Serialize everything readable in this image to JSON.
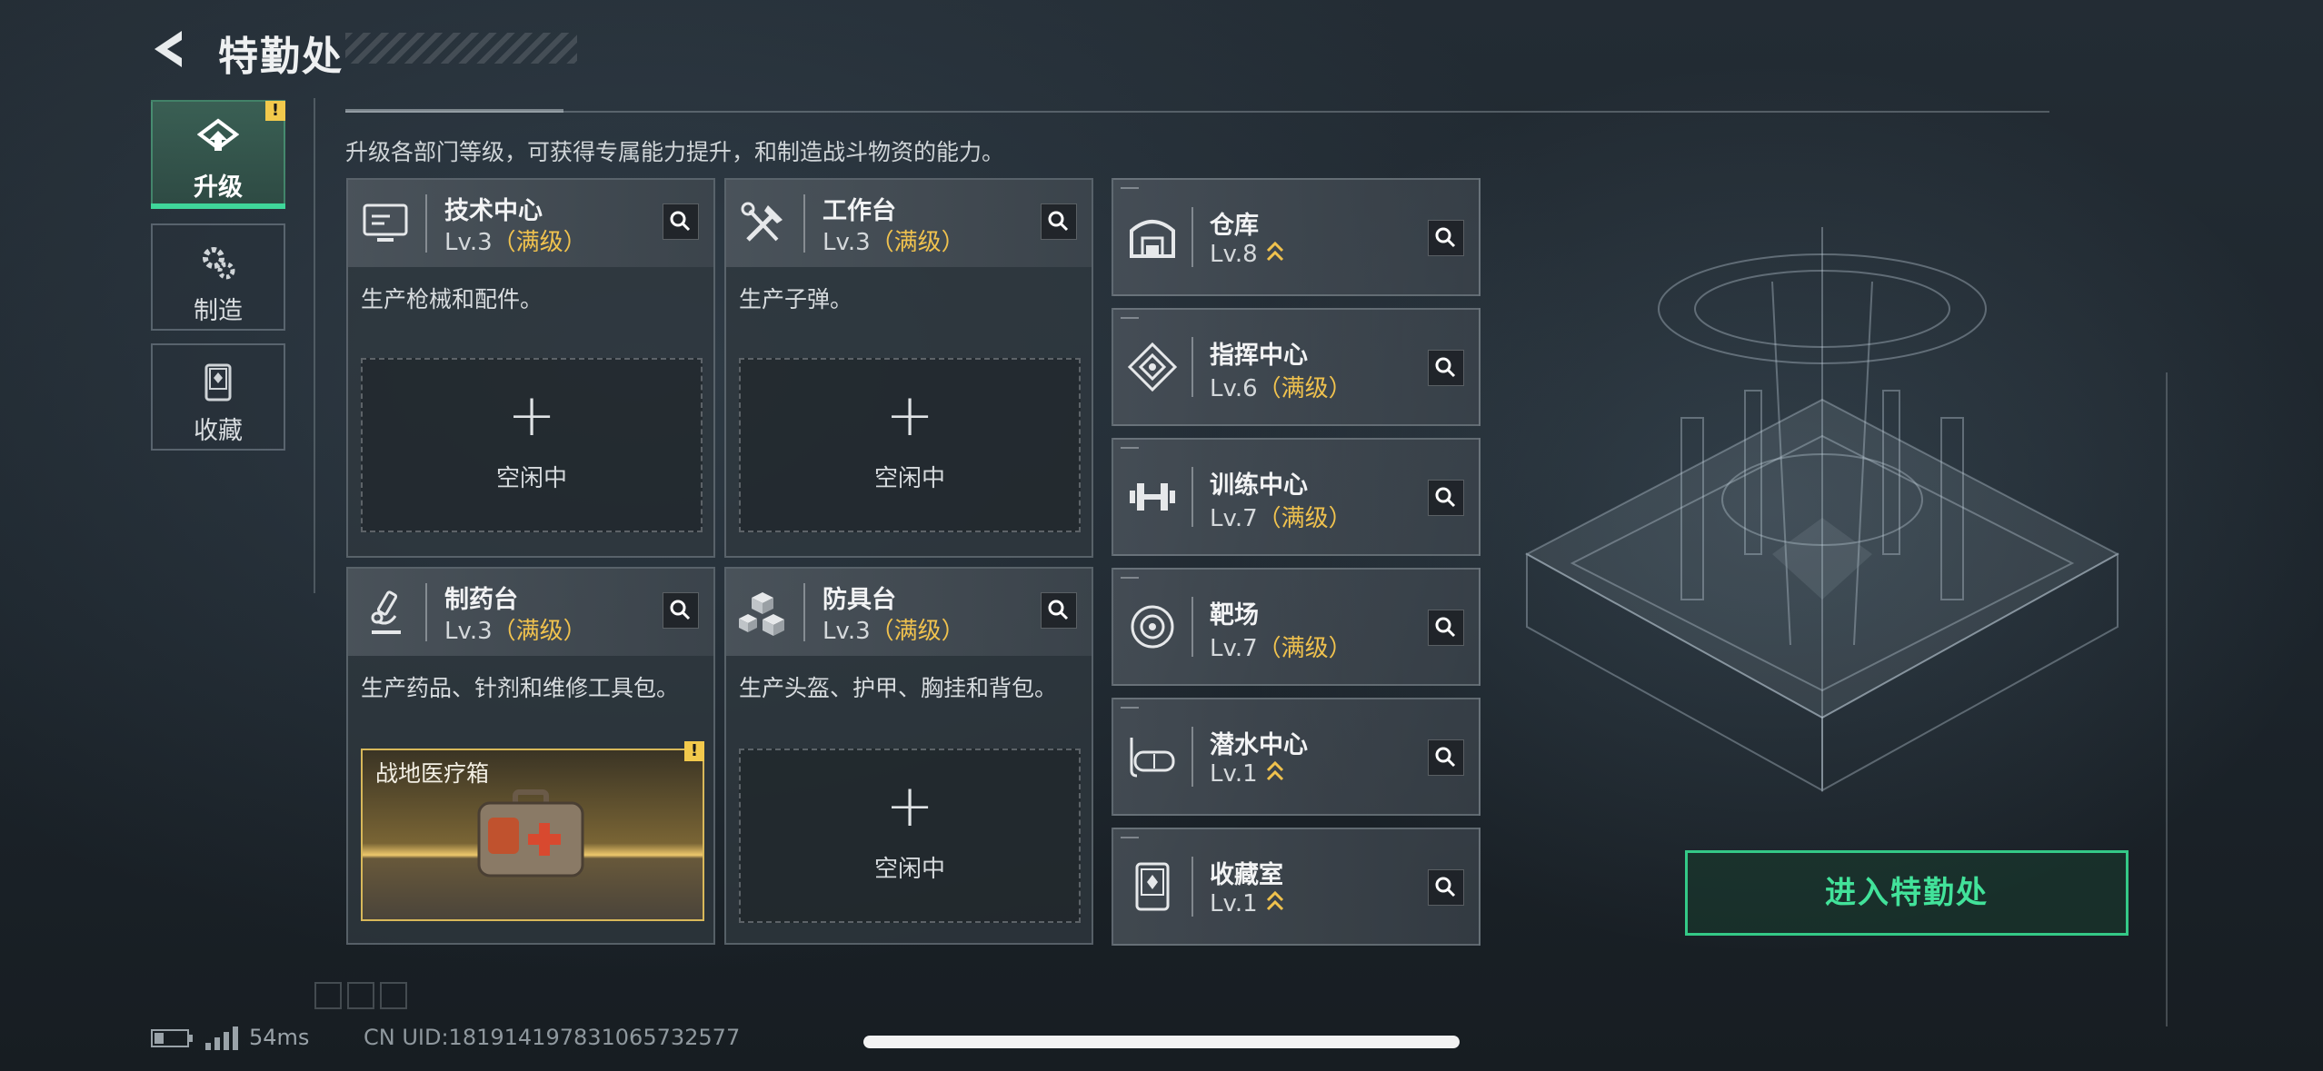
{
  "header": {
    "title": "特勤处",
    "back_icon": "back-arrow-icon"
  },
  "tabs": [
    {
      "label": "升级",
      "icon": "upgrade-icon",
      "active": true,
      "badge": "!"
    },
    {
      "label": "制造",
      "icon": "gears-icon",
      "active": false
    },
    {
      "label": "收藏",
      "icon": "collection-icon",
      "active": false
    }
  ],
  "intro": "升级各部门等级，可获得专属能力提升，和制造战斗物资的能力。",
  "workshops": [
    {
      "name": "技术中心",
      "level": "Lv.3",
      "max": "（满级）",
      "icon": "monitor-icon",
      "desc": "生产枪械和配件。",
      "slot": {
        "plus": "+",
        "label": "空闲中"
      }
    },
    {
      "name": "工作台",
      "level": "Lv.3",
      "max": "（满级）",
      "icon": "tools-icon",
      "desc": "生产子弹。",
      "slot": {
        "plus": "+",
        "label": "空闲中"
      }
    },
    {
      "name": "制药台",
      "level": "Lv.3",
      "max": "（满级）",
      "icon": "microscope-icon",
      "desc": "生产药品、针剂和维修工具包。",
      "product": {
        "name": "战地医疗箱",
        "badge": "!",
        "icon": "medkit-icon"
      }
    },
    {
      "name": "防具台",
      "level": "Lv.3",
      "max": "（满级）",
      "icon": "armor-blocks-icon",
      "desc": "生产头盔、护甲、胸挂和背包。",
      "slot": {
        "plus": "+",
        "label": "空闲中"
      }
    }
  ],
  "rooms": [
    {
      "name": "仓库",
      "level": "Lv.8",
      "max": "",
      "upgradable": true,
      "icon": "warehouse-icon"
    },
    {
      "name": "指挥中心",
      "level": "Lv.6",
      "max": "（满级）",
      "upgradable": false,
      "icon": "command-icon"
    },
    {
      "name": "训练中心",
      "level": "Lv.7",
      "max": "（满级）",
      "upgradable": false,
      "icon": "dumbbell-icon"
    },
    {
      "name": "靶场",
      "level": "Lv.7",
      "max": "（满级）",
      "upgradable": false,
      "icon": "target-icon"
    },
    {
      "name": "潜水中心",
      "level": "Lv.1",
      "max": "",
      "upgradable": true,
      "icon": "diving-mask-icon"
    },
    {
      "name": "收藏室",
      "level": "Lv.1",
      "max": "",
      "upgradable": true,
      "icon": "display-case-icon"
    }
  ],
  "enter_button": "进入特勤处",
  "status": {
    "ping": "54ms",
    "uid": "CN UID:181914197831065732577"
  },
  "colors": {
    "accent_green": "#42e29a",
    "max_level": "#f0c24e",
    "badge": "#f2c94c"
  }
}
